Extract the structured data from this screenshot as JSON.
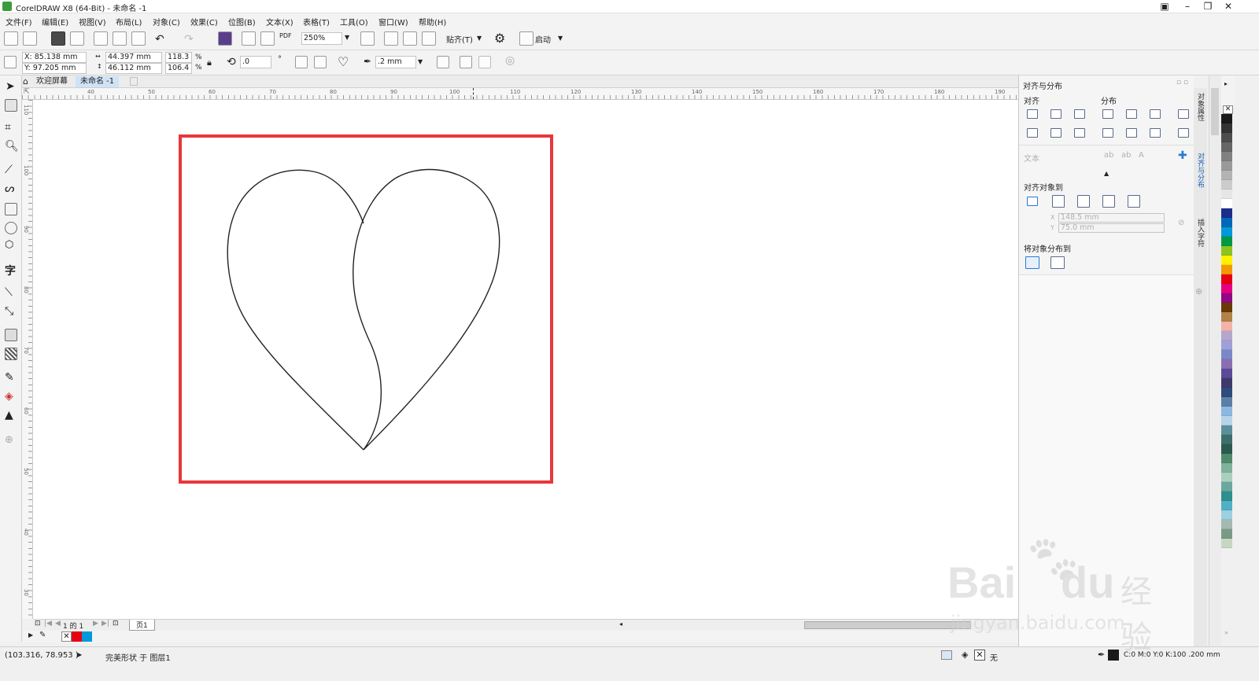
{
  "window": {
    "title": "CorelDRAW X8 (64-Bit) - 未命名 -1"
  },
  "menu": [
    "文件(F)",
    "编辑(E)",
    "视图(V)",
    "布局(L)",
    "对象(C)",
    "效果(C)",
    "位图(B)",
    "文本(X)",
    "表格(T)",
    "工具(O)",
    "窗口(W)",
    "帮助(H)"
  ],
  "toolbar": {
    "zoom": "250%",
    "snap_label": "贴齐(T)",
    "launch_label": "启动",
    "pdf": "PDF"
  },
  "props": {
    "x": "X: 85.138 mm",
    "y": "Y: 97.205 mm",
    "width": "44.397 mm",
    "height": "46.112 mm",
    "scale_w": "118.3",
    "scale_h": "106.4",
    "pct": "%",
    "rotation": ".0",
    "deg": "°",
    "outline": ".2 mm"
  },
  "tabs": {
    "welcome": "欢迎屏幕",
    "doc": "未命名 -1"
  },
  "ruler_h": [
    "40",
    "50",
    "60",
    "70",
    "80",
    "90",
    "100",
    "110",
    "120",
    "130",
    "140",
    "150",
    "160",
    "170",
    "180",
    "190"
  ],
  "ruler_v": [
    "110",
    "100",
    "90",
    "80",
    "70",
    "60",
    "50",
    "40",
    "30"
  ],
  "pages": {
    "count": "1 的 1",
    "tab": "页1"
  },
  "status": {
    "coords": "(103.316, 78.953 )",
    "shape_info": "完美形状 于 图层1",
    "fill": "无",
    "outline": "C:0 M:0 Y:0 K:100 .200 mm"
  },
  "docker": {
    "title": "对齐与分布",
    "align": "对齐",
    "distribute": "分布",
    "text_label": "文本",
    "align_to": "对齐对象到",
    "x_val": "148.5 mm",
    "y_val": "75.0 mm",
    "distribute_to": "将对象分布到",
    "x_short": "X",
    "y_short": "Y"
  },
  "docker_tabs": [
    "对象属性",
    "对齐与分布",
    "插入字符"
  ],
  "colors": {
    "highlight": "#e8373a",
    "palette": [
      "#1a1a1a",
      "#333333",
      "#4d4d4d",
      "#666666",
      "#808080",
      "#999999",
      "#b3b3b3",
      "#cccccc",
      "#e6e6e6",
      "#ffffff",
      "#1c2e8c",
      "#0068b7",
      "#0099d9",
      "#009944",
      "#8fc31f",
      "#fff100",
      "#f39800",
      "#e60012",
      "#e4007f",
      "#920783",
      "#6a3906",
      "#b28247",
      "#f4b3a6",
      "#b5a6cf",
      "#9fa0d7",
      "#7a88c9",
      "#8a6fb0",
      "#5b4a9a",
      "#3e3a6b",
      "#2f4b7c",
      "#5c7fa6",
      "#8bb7e0",
      "#b7d3ea",
      "#5b8f9c",
      "#3e6e6a",
      "#2b5a4e",
      "#4f8a6a",
      "#7fb29a",
      "#a9cfbd",
      "#6aa79d",
      "#2f8e8e",
      "#4fb0c6",
      "#9ccfdf",
      "#a5b8b1",
      "#7a9a88",
      "#c6d7c4"
    ]
  },
  "watermark": {
    "brand": "Bai",
    "brand2": "du",
    "product": "经验",
    "url": "jingyan.baidu.com"
  }
}
